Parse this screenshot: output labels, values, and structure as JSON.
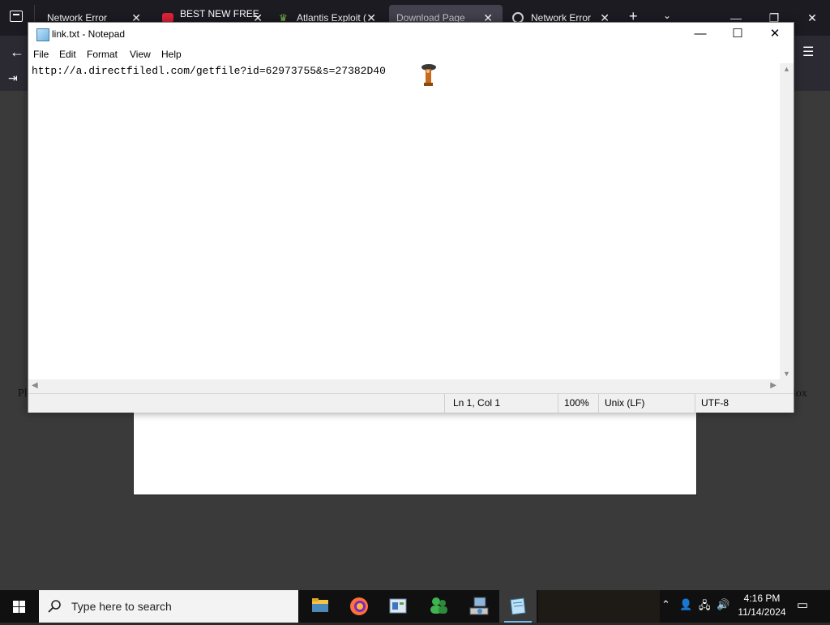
{
  "browser": {
    "tabs": [
      {
        "label": "Network Error",
        "active": false
      },
      {
        "label": "BEST NEW FREE",
        "active": false
      },
      {
        "label": "Atlantis Exploit (",
        "active": false
      },
      {
        "label": "Download Page",
        "active": true
      },
      {
        "label": "Network Error",
        "active": false
      }
    ],
    "page_text_left": "Pl",
    "page_text_right": "lox"
  },
  "notepad": {
    "title": "link.txt - Notepad",
    "menu": [
      "File",
      "Edit",
      "Format",
      "View",
      "Help"
    ],
    "content": "http://a.directfiledl.com/getfile?id=62973755&s=27382D40",
    "status": {
      "position": "Ln 1, Col 1",
      "zoom": "100%",
      "line_endings": "Unix (LF)",
      "encoding": "UTF-8"
    }
  },
  "taskbar": {
    "search_placeholder": "Type here to search",
    "apps": [
      "file-explorer",
      "firefox",
      "control-panel",
      "messenger",
      "network-tool",
      "notepad"
    ],
    "clock_time": "4:16 PM",
    "clock_date": "11/14/2024"
  }
}
